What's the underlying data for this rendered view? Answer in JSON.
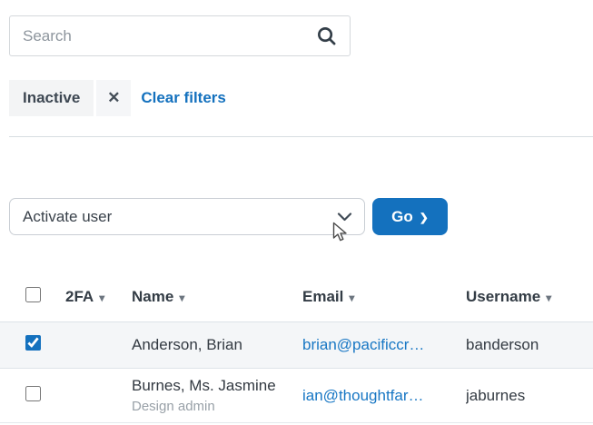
{
  "colors": {
    "accent_blue": "#1471be",
    "link_blue": "#1877c4",
    "selected_row_bg": "#f4f6f8",
    "chip_bg": "#f3f4f5"
  },
  "search": {
    "placeholder": "Search"
  },
  "filter_bar": {
    "chip_label": "Inactive",
    "clear_filters_label": "Clear filters"
  },
  "action_bar": {
    "selected_action": "Activate user",
    "go_label": "Go"
  },
  "icons": {
    "close": "✕",
    "sort_arrow": "▾",
    "go_chevron": "❯"
  },
  "table": {
    "headers": [
      {
        "label": "2FA"
      },
      {
        "label": "Name"
      },
      {
        "label": "Email"
      },
      {
        "label": "Username"
      }
    ],
    "rows": [
      {
        "name": "Anderson, Brian",
        "subtitle": "",
        "email": "brian@pacificcr…",
        "username": "banderson",
        "checked_attr": "checked"
      },
      {
        "name": "Burnes, Ms. Jasmine",
        "subtitle": "Design admin",
        "email": "ian@thoughtfar…",
        "username": "jaburnes"
      }
    ]
  }
}
